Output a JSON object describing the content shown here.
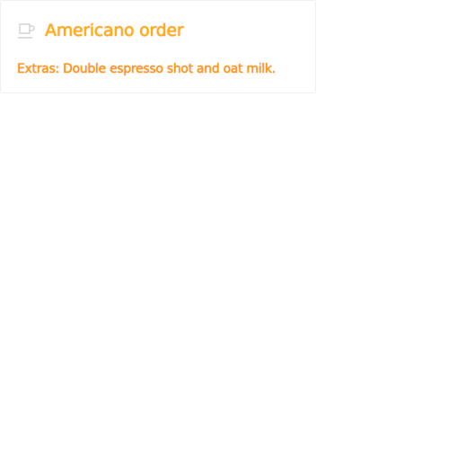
{
  "card": {
    "icon": "coffee-cup-icon",
    "title": "Americano order",
    "extras": "Extras: Double espresso shot and oat milk."
  },
  "colors": {
    "title_text": "#ffb300",
    "body_text": "#ffa000",
    "text_fringe": "#e53935",
    "icon": "#d6d6d6",
    "card_border": "#f0f0f0",
    "background": "#ffffff"
  }
}
